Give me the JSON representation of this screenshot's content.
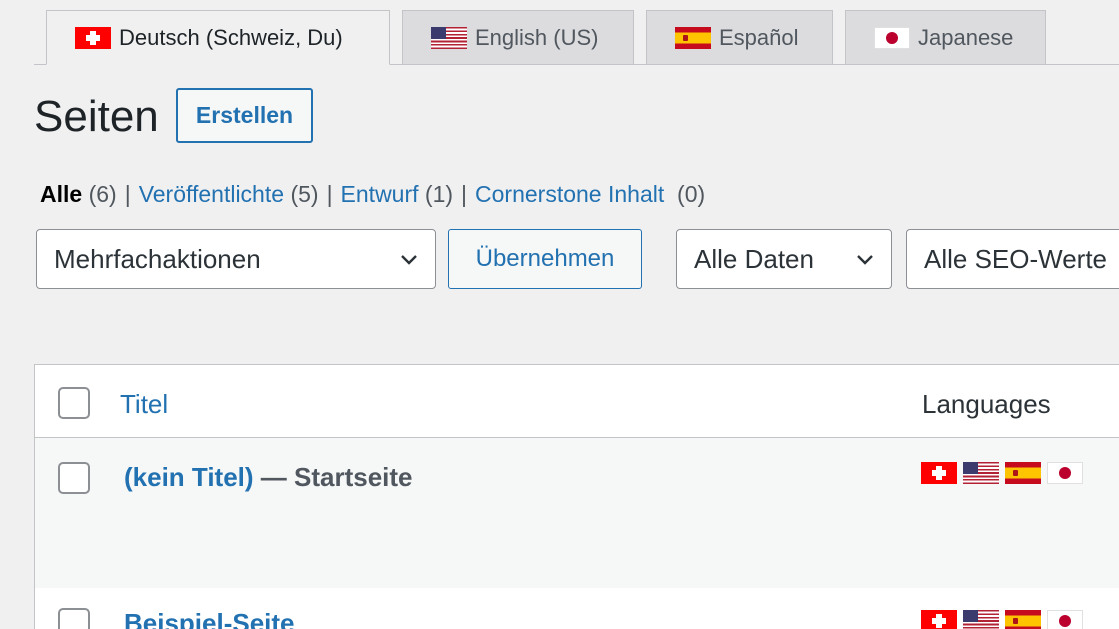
{
  "language_tabs": [
    {
      "label": "Deutsch (Schweiz, Du)",
      "flag": "flag-ch-icon",
      "active": true
    },
    {
      "label": "English (US)",
      "flag": "flag-us-icon",
      "active": false
    },
    {
      "label": "Español",
      "flag": "flag-es-icon",
      "active": false
    },
    {
      "label": "Japanese",
      "flag": "flag-jp-icon",
      "active": false
    }
  ],
  "header": {
    "title": "Seiten",
    "create_label": "Erstellen"
  },
  "filters": {
    "all": {
      "label": "Alle",
      "count": "(6)"
    },
    "published": {
      "label": "Veröffentlichte",
      "count": "(5)"
    },
    "draft": {
      "label": "Entwurf",
      "count": "(1)"
    },
    "cornerstone": {
      "label": "Cornerstone Inhalt",
      "count": "(0)"
    },
    "separator": "|"
  },
  "controls": {
    "bulk_actions": "Mehrfachaktionen",
    "apply_label": "Übernehmen",
    "date_filter": "Alle Daten",
    "seo_filter": "Alle SEO-Werte"
  },
  "table": {
    "columns": {
      "title": "Titel",
      "languages": "Languages"
    },
    "rows": [
      {
        "title": "(kein Titel)",
        "state": "— Startseite",
        "languages": [
          "flag-ch-icon",
          "flag-us-icon",
          "flag-es-icon",
          "flag-jp-icon"
        ]
      },
      {
        "title": "Beispiel-Seite",
        "state": "",
        "languages": [
          "flag-ch-icon",
          "flag-us-icon",
          "flag-es-icon",
          "flag-jp-icon"
        ]
      }
    ]
  },
  "colors": {
    "link": "#2271b1",
    "background": "#f0f0f1",
    "border": "#c3c4c7"
  }
}
